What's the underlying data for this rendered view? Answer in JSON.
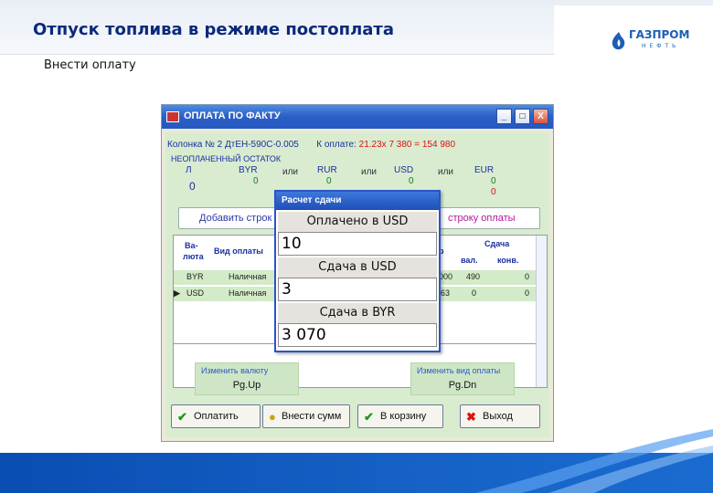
{
  "slide": {
    "title": "Отпуск топлива в режиме постоплата",
    "subtitle": "Внести оплату",
    "logo_text": "ГАЗПРОМ",
    "logo_sub": "НЕФТЬ"
  },
  "window": {
    "title": "ОПЛАТА ПО ФАКТУ",
    "btn_minimize": "_",
    "btn_maximize": "□",
    "btn_close": "X",
    "info": {
      "column": "Колонка № 2 ДтЕН-590С-0.005",
      "to_pay_label": "К оплате:",
      "to_pay_expr": "21.23х  7 380 =",
      "to_pay_total": "154 980"
    },
    "unpaid_label": "НЕОПЛАЧЕННЫЙ ОСТАТОК",
    "currencies": {
      "l_label": "Л",
      "l_value": "0",
      "byr_label": "BYR",
      "byr_value": "0",
      "rur_label": "RUR",
      "rur_value": "0",
      "usd_label": "USD",
      "usd_value": "0",
      "eur_label": "EUR",
      "eur_value1": "0",
      "eur_value2": "0",
      "or": "или"
    },
    "add_row_label": "Добавить строк",
    "del_row_label": "строку оплаты",
    "grid": {
      "col_currency": "Ва-\nлюта",
      "col_currency_1": "Ва-",
      "col_currency_2": "люта",
      "col_pay_type": "Вид оплаты",
      "col_change": "Сдача",
      "col_val": "вал.",
      "col_conv": "конв.",
      "col_r": "р",
      "rows": [
        {
          "currency": "BYR",
          "type": "Наличная",
          "amount": "000",
          "val": "490",
          "conv": "0"
        },
        {
          "currency": "USD",
          "type": "Наличная",
          "amount": "63",
          "val": "0",
          "conv": "0"
        }
      ]
    },
    "hints": {
      "currency_hint": "Изменить валюту",
      "currency_key": "Pg.Up",
      "paytype_hint": "Изменить вид оплаты",
      "paytype_key": "Pg.Dn"
    },
    "buttons": {
      "pay": "Оплатить",
      "enter_sum": "Внести сумм",
      "to_cart": "В корзину",
      "exit": "Выход"
    }
  },
  "popup": {
    "title": "Расчет сдачи",
    "paid_label": "Оплачено в USD",
    "paid_value": "10",
    "change_usd_label": "Сдача в USD",
    "change_usd_value": "3",
    "change_byr_label": "Сдача в BYR",
    "change_byr_value": "3 070"
  },
  "colors": {
    "title_blue": "#0a2a7a",
    "footer_blue": "#1662c6",
    "window_green": "#d9ecd0",
    "accent_red": "#d11111"
  }
}
